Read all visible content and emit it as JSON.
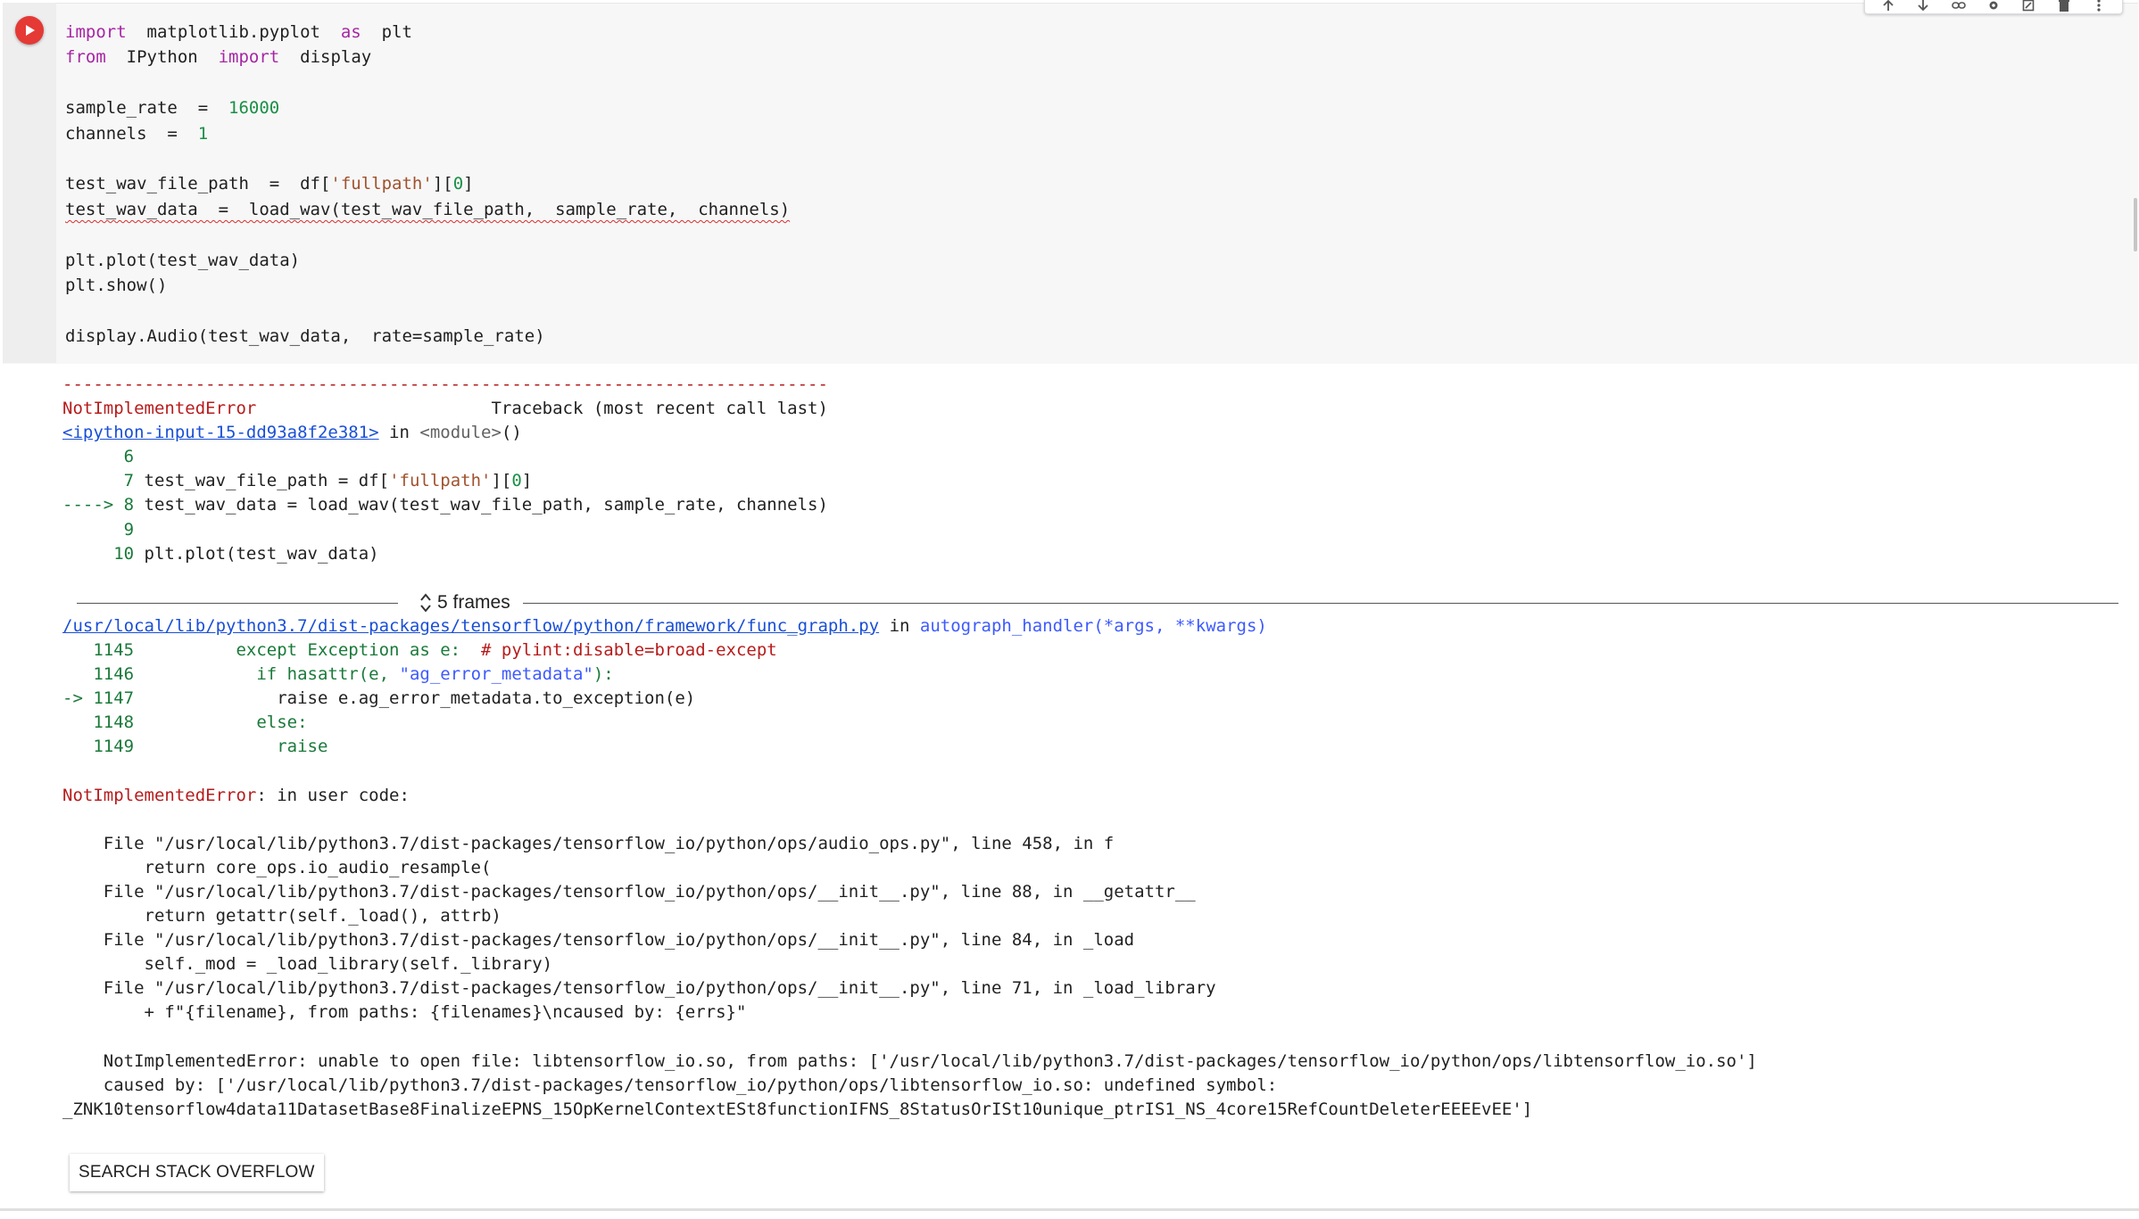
{
  "code": {
    "lines": [
      [
        {
          "t": "import",
          "c": "kw"
        },
        {
          "t": "  matplotlib.pyplot  "
        },
        {
          "t": "as",
          "c": "kw"
        },
        {
          "t": "  plt"
        }
      ],
      [
        {
          "t": "from",
          "c": "kw"
        },
        {
          "t": "  IPython  "
        },
        {
          "t": "import",
          "c": "kw"
        },
        {
          "t": "  display"
        }
      ],
      [],
      [
        {
          "t": "sample_rate  =  "
        },
        {
          "t": "16000",
          "c": "num"
        }
      ],
      [
        {
          "t": "channels  =  "
        },
        {
          "t": "1",
          "c": "num"
        }
      ],
      [],
      [
        {
          "t": "test_wav_file_path  =  df["
        },
        {
          "t": "'fullpath'",
          "c": "str"
        },
        {
          "t": "]["
        },
        {
          "t": "0",
          "c": "num"
        },
        {
          "t": "]"
        }
      ],
      [
        {
          "t": "test_wav_data  =  load_wav(test_wav_file_path,  sample_rate,  channels)",
          "c": "squiggle"
        }
      ],
      [],
      [
        {
          "t": "plt.plot(test_wav_data)"
        }
      ],
      [
        {
          "t": "plt.show()"
        }
      ],
      [],
      [
        {
          "t": "display.Audio(test_wav_data,  rate=sample_rate)"
        }
      ]
    ]
  },
  "output": {
    "lines": [
      [
        {
          "t": "---------------------------------------------------------------------------",
          "c": "err"
        }
      ],
      [
        {
          "t": "NotImplementedError",
          "c": "err"
        },
        {
          "t": "                       Traceback (most recent call last)"
        }
      ],
      [
        {
          "t": "<ipython-input-15-dd93a8f2e381>",
          "c": "link"
        },
        {
          "t": " in "
        },
        {
          "t": "<module>",
          "c": "dim"
        },
        {
          "t": "()"
        }
      ],
      [
        {
          "t": "      6",
          "c": "ln"
        }
      ],
      [
        {
          "t": "      7",
          "c": "ln"
        },
        {
          "t": " test_wav_file_path = df["
        },
        {
          "t": "'fullpath'",
          "c": "str"
        },
        {
          "t": "]["
        },
        {
          "t": "0",
          "c": "num"
        },
        {
          "t": "]"
        }
      ],
      [
        {
          "t": "----> 8",
          "c": "ln"
        },
        {
          "t": " test_wav_data = load_wav(test_wav_file_path, sample_rate, channels)"
        }
      ],
      [
        {
          "t": "      9",
          "c": "ln"
        }
      ],
      [
        {
          "t": "     10",
          "c": "ln"
        },
        {
          "t": " plt.plot(test_wav_data)"
        }
      ],
      [],
      [],
      [
        {
          "t": "/usr/local/lib/python3.7/dist-packages/tensorflow/python/framework/func_graph.py",
          "c": "link"
        },
        {
          "t": " in "
        },
        {
          "t": "autograph_handler",
          "c": "fn"
        },
        {
          "t": "(*args, **kwargs)",
          "c": "fn"
        }
      ],
      [
        {
          "t": "   1145",
          "c": "ln"
        },
        {
          "t": "          except Exception as e:  ",
          "c": "ln"
        },
        {
          "t": "# pylint:disable=broad-except",
          "c": "err"
        }
      ],
      [
        {
          "t": "   1146",
          "c": "ln"
        },
        {
          "t": "            if hasattr(e, ",
          "c": "ln"
        },
        {
          "t": "\"ag_error_metadata\"",
          "c": "fn"
        },
        {
          "t": "):",
          "c": "ln"
        }
      ],
      [
        {
          "t": "-> 1147",
          "c": "ln"
        },
        {
          "t": "              raise e.ag_error_metadata.to_exception(e)"
        }
      ],
      [
        {
          "t": "   1148",
          "c": "ln"
        },
        {
          "t": "            else:",
          "c": "ln"
        }
      ],
      [
        {
          "t": "   1149",
          "c": "ln"
        },
        {
          "t": "              raise",
          "c": "ln"
        }
      ],
      [],
      [
        {
          "t": "NotImplementedError",
          "c": "err"
        },
        {
          "t": ": in user code:"
        }
      ],
      [],
      [
        {
          "t": "    File \"/usr/local/lib/python3.7/dist-packages/tensorflow_io/python/ops/audio_ops.py\", line 458, in f"
        }
      ],
      [
        {
          "t": "        return core_ops.io_audio_resample("
        }
      ],
      [
        {
          "t": "    File \"/usr/local/lib/python3.7/dist-packages/tensorflow_io/python/ops/__init__.py\", line 88, in __getattr__"
        }
      ],
      [
        {
          "t": "        return getattr(self._load(), attrb)"
        }
      ],
      [
        {
          "t": "    File \"/usr/local/lib/python3.7/dist-packages/tensorflow_io/python/ops/__init__.py\", line 84, in _load"
        }
      ],
      [
        {
          "t": "        self._mod = _load_library(self._library)"
        }
      ],
      [
        {
          "t": "    File \"/usr/local/lib/python3.7/dist-packages/tensorflow_io/python/ops/__init__.py\", line 71, in _load_library"
        }
      ],
      [
        {
          "t": "        + f\"{filename}, from paths: {filenames}\\ncaused by: {errs}\""
        }
      ],
      [],
      [
        {
          "t": "    NotImplementedError: unable to open file: libtensorflow_io.so, from paths: ['/usr/local/lib/python3.7/dist-packages/tensorflow_io/python/ops/libtensorflow_io.so']"
        }
      ],
      [
        {
          "t": "    caused by: ['/usr/local/lib/python3.7/dist-packages/tensorflow_io/python/ops/libtensorflow_io.so: undefined symbol:"
        }
      ],
      [
        {
          "t": "_ZNK10tensorflow4data11DatasetBase8FinalizeEPNS_15OpKernelContextESt8functionIFNS_8StatusOrISt10unique_ptrIS1_NS_4core15RefCountDeleterEEEEvEE']"
        }
      ]
    ]
  },
  "frames": {
    "label": "5 frames"
  },
  "stack_overflow_button": "SEARCH STACK OVERFLOW",
  "toolbar": {
    "icons": [
      "move-up-icon",
      "move-down-icon",
      "link-icon",
      "settings-icon",
      "mirror-cell-icon",
      "delete-icon",
      "more-icon"
    ]
  }
}
